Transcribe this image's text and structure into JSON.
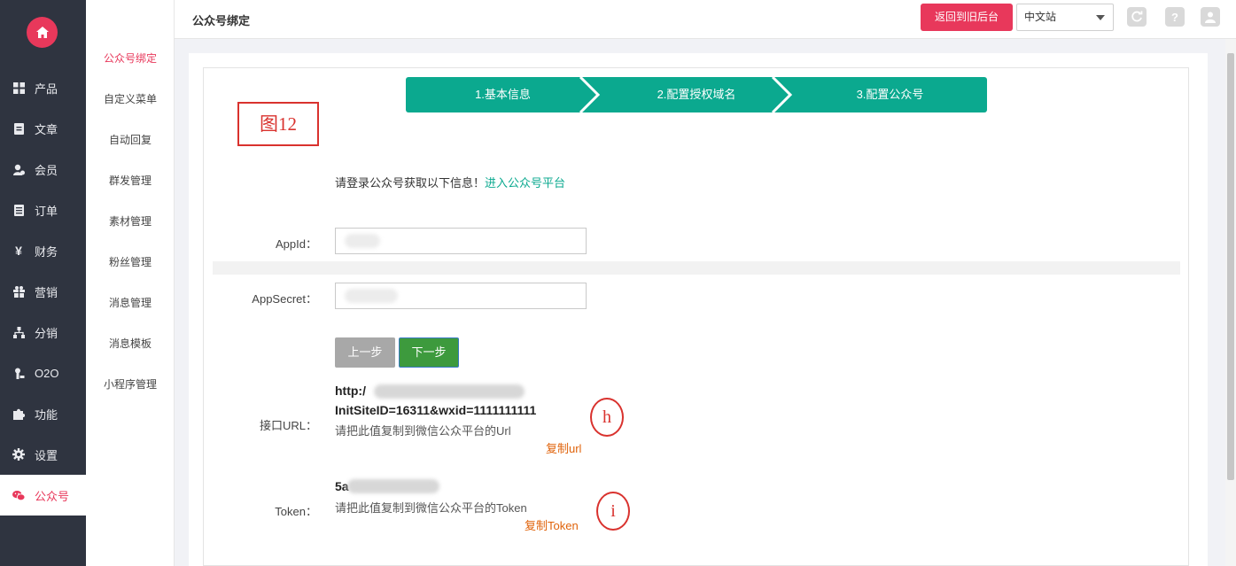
{
  "sidebar": {
    "items": [
      {
        "label": "产品",
        "icon": "grid-icon"
      },
      {
        "label": "文章",
        "icon": "document-icon"
      },
      {
        "label": "会员",
        "icon": "user-icon"
      },
      {
        "label": "订单",
        "icon": "list-icon"
      },
      {
        "label": "财务",
        "icon": "yen-icon"
      },
      {
        "label": "营销",
        "icon": "gift-icon"
      },
      {
        "label": "分销",
        "icon": "sitemap-icon"
      },
      {
        "label": "O2O",
        "icon": "user-pin-icon"
      },
      {
        "label": "功能",
        "icon": "puzzle-icon"
      },
      {
        "label": "设置",
        "icon": "gear-icon"
      },
      {
        "label": "公众号",
        "icon": "wechat-icon"
      }
    ],
    "active_index": 10
  },
  "subnav": {
    "items": [
      "公众号绑定",
      "自定义菜单",
      "自动回复",
      "群发管理",
      "素材管理",
      "粉丝管理",
      "消息管理",
      "消息模板",
      "小程序管理"
    ],
    "active_index": 0
  },
  "topbar": {
    "title": "公众号绑定",
    "back_label": "返回到旧后台",
    "lang_value": "中文站"
  },
  "steps": [
    "1.基本信息",
    "2.配置授权域名",
    "3.配置公众号"
  ],
  "figure_label": "图12",
  "info": {
    "text": "请登录公众号获取以下信息！",
    "link": "进入公众号平台"
  },
  "form": {
    "appid_label": "AppId：",
    "appsecret_label": "AppSecret：",
    "prev_label": "上一步",
    "next_label": "下一步",
    "url_label": "接口URL：",
    "url_line1": "http:/",
    "url_line2": "InitSiteID=16311&wxid=1111111111",
    "url_hint": "请把此值复制到微信公众平台的Url",
    "copy_url": "复制url",
    "token_label": "Token：",
    "token_value": "5a",
    "token_hint": "请把此值复制到微信公众平台的Token",
    "copy_token": "复制Token"
  },
  "annotations": {
    "h": "h",
    "i": "i"
  },
  "colors": {
    "accent": "#e8385b",
    "teal": "#0ba98f",
    "green": "#3d9a3d",
    "orange": "#e0630b",
    "sidebar": "#2f3440"
  }
}
